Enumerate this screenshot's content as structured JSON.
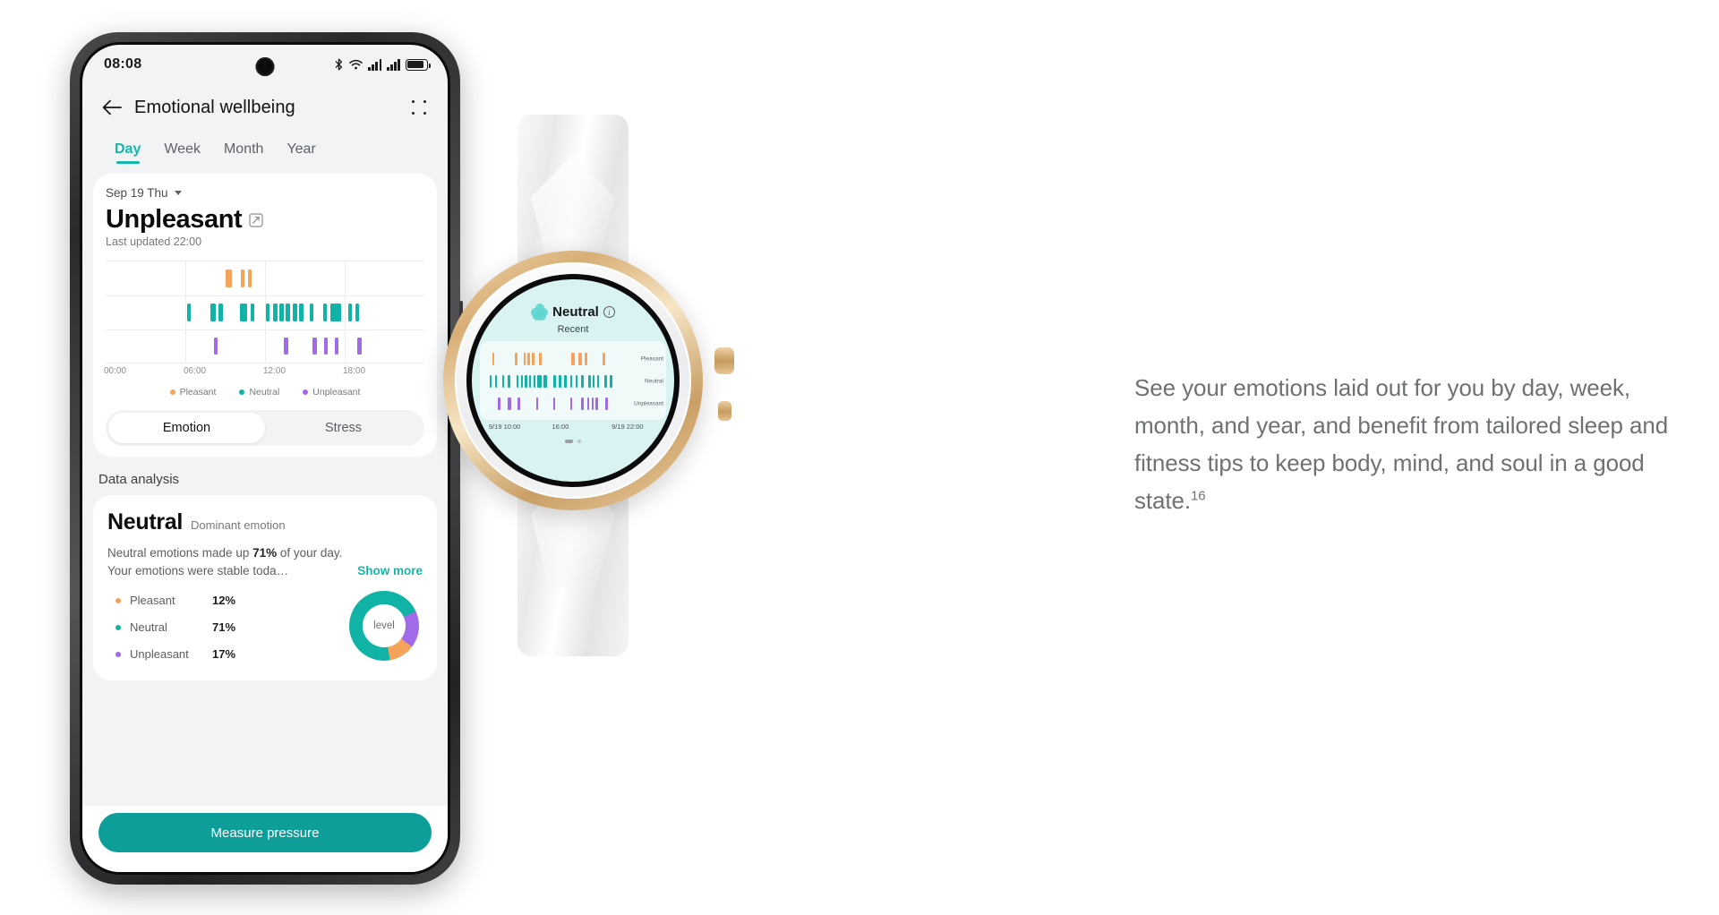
{
  "phone": {
    "status_bar": {
      "time": "08:08",
      "icons": [
        "bluetooth-icon",
        "wifi-icon",
        "signal-icon",
        "signal-icon",
        "battery-icon"
      ]
    },
    "app_bar": {
      "back_icon": "back-arrow-icon",
      "title": "Emotional wellbeing",
      "more_icon": "more-options-icon"
    },
    "tabs": [
      {
        "label": "Day",
        "active": true
      },
      {
        "label": "Week",
        "active": false
      },
      {
        "label": "Month",
        "active": false
      },
      {
        "label": "Year",
        "active": false
      }
    ],
    "summary_card": {
      "date": "Sep 19 Thu",
      "date_caret_icon": "chevron-down-icon",
      "mood": "Unpleasant",
      "edit_icon": "edit-note-icon",
      "last_updated": "Last updated 22:00"
    },
    "segmented": [
      {
        "label": "Emotion",
        "active": true
      },
      {
        "label": "Stress",
        "active": false
      }
    ],
    "data_analysis": {
      "section_title": "Data analysis",
      "dominant_value": "Neutral",
      "dominant_label": "Dominant emotion",
      "summary_line1_pre": "Neutral emotions made up ",
      "summary_line1_bold": "71%",
      "summary_line1_post": " of your day.",
      "summary_line2": "Your emotions were stable toda…",
      "show_more": "Show more",
      "breakdown": [
        {
          "name": "Pleasant",
          "percent": "12%",
          "color": "#f5a35a"
        },
        {
          "name": "Neutral",
          "percent": "71%",
          "color": "#10b3a5"
        },
        {
          "name": "Unpleasant",
          "percent": "17%",
          "color": "#a06ae8"
        }
      ],
      "donut_center_label": "level"
    },
    "measure_button": "Measure pressure"
  },
  "watch": {
    "mood": "Neutral",
    "info_icon": "info-icon",
    "flower_icon": "flower-icon",
    "recent_label": "Recent",
    "lane_labels": [
      "Pleasant",
      "Neutral",
      "Unpleasant"
    ],
    "x_labels": [
      "9/19 10:00",
      "16:00",
      "9/19 22:00"
    ],
    "page_indicator": "page-indicator"
  },
  "copy": {
    "text": "See your emotions laid out for you by day, week, month, and year, and benefit from tailored sleep and fitness tips to keep body, mind, and soul in a good state.",
    "footnote": "16"
  },
  "colors": {
    "accent": "#14b8a8",
    "button": "#0e9e9a",
    "pleasant": "#f5a35a",
    "neutral": "#10b3a5",
    "unpleasant": "#a06ae8"
  },
  "chart_data": {
    "type": "bar",
    "title": "Emotion timeline (Day)",
    "xlabel": "",
    "ylabel": "",
    "x_tick_labels": [
      "00:00",
      "06:00",
      "12:00",
      "18:00"
    ],
    "x_tick_positions_pct": [
      0,
      25,
      50,
      75
    ],
    "xlim_hours": [
      0,
      24
    ],
    "grid": true,
    "legend": [
      "Pleasant",
      "Neutral",
      "Unpleasant"
    ],
    "legend_position": "bottom-center",
    "series": [
      {
        "name": "Pleasant",
        "color": "#f5a35a",
        "lane": 0,
        "events_pct": [
          {
            "x": 37.5,
            "w": 2.2
          },
          {
            "x": 42.5,
            "w": 1.1
          },
          {
            "x": 44.6,
            "w": 1.1
          }
        ]
      },
      {
        "name": "Neutral",
        "color": "#10b3a5",
        "lane": 1,
        "events_pct": [
          {
            "x": 25.5,
            "w": 1.1
          },
          {
            "x": 33.0,
            "w": 1.5
          },
          {
            "x": 35.4,
            "w": 1.5
          },
          {
            "x": 42.0,
            "w": 2.3
          },
          {
            "x": 45.4,
            "w": 1.1
          },
          {
            "x": 50.4,
            "w": 1.1
          },
          {
            "x": 52.6,
            "w": 1.4
          },
          {
            "x": 54.6,
            "w": 1.4
          },
          {
            "x": 56.6,
            "w": 1.4
          },
          {
            "x": 58.6,
            "w": 1.4
          },
          {
            "x": 60.6,
            "w": 1.4
          },
          {
            "x": 64.0,
            "w": 1.1
          },
          {
            "x": 68.2,
            "w": 1.1
          },
          {
            "x": 70.6,
            "w": 3.4
          },
          {
            "x": 76.0,
            "w": 1.2
          },
          {
            "x": 78.4,
            "w": 1.2
          }
        ]
      },
      {
        "name": "Unpleasant",
        "color": "#a06ae8",
        "lane": 2,
        "events_pct": [
          {
            "x": 34.0,
            "w": 1.2
          },
          {
            "x": 56.0,
            "w": 1.2
          },
          {
            "x": 65.0,
            "w": 1.2
          },
          {
            "x": 68.4,
            "w": 1.2
          },
          {
            "x": 71.8,
            "w": 1.2
          },
          {
            "x": 79.0,
            "w": 1.2
          }
        ]
      }
    ]
  },
  "watch_chart_data": {
    "type": "bar",
    "title": "Recent",
    "x_tick_labels": [
      "9/19 10:00",
      "16:00",
      "9/19 22:00"
    ],
    "x_tick_positions_pct": [
      2,
      38,
      72
    ],
    "lanes": [
      "Pleasant",
      "Neutral",
      "Unpleasant"
    ],
    "series": [
      {
        "name": "Pleasant",
        "color": "#f5a35a",
        "lane": 0,
        "events_pct": [
          {
            "x": 5,
            "w": 1.6
          },
          {
            "x": 21,
            "w": 1.6
          },
          {
            "x": 27,
            "w": 1.6
          },
          {
            "x": 30,
            "w": 1.6
          },
          {
            "x": 33,
            "w": 1.6
          },
          {
            "x": 38,
            "w": 1.6
          },
          {
            "x": 61,
            "w": 2.0
          },
          {
            "x": 66,
            "w": 2.6
          },
          {
            "x": 70,
            "w": 2.0
          },
          {
            "x": 83,
            "w": 1.6
          }
        ]
      },
      {
        "name": "Neutral",
        "color": "#10b3a5",
        "lane": 1,
        "events_pct": [
          {
            "x": 3,
            "w": 1.5
          },
          {
            "x": 7,
            "w": 1.5
          },
          {
            "x": 12,
            "w": 1.5
          },
          {
            "x": 16,
            "w": 1.5
          },
          {
            "x": 22,
            "w": 1.5
          },
          {
            "x": 25,
            "w": 1.5
          },
          {
            "x": 28,
            "w": 1.5
          },
          {
            "x": 31,
            "w": 1.5
          },
          {
            "x": 34,
            "w": 1.5
          },
          {
            "x": 37,
            "w": 2.6
          },
          {
            "x": 41,
            "w": 2.6
          },
          {
            "x": 48,
            "w": 2.0
          },
          {
            "x": 52,
            "w": 1.5
          },
          {
            "x": 56,
            "w": 1.5
          },
          {
            "x": 60,
            "w": 1.5
          },
          {
            "x": 64,
            "w": 1.5
          },
          {
            "x": 68,
            "w": 1.5
          },
          {
            "x": 73,
            "w": 1.5
          },
          {
            "x": 76,
            "w": 1.5
          },
          {
            "x": 79,
            "w": 1.5
          },
          {
            "x": 84,
            "w": 1.8
          },
          {
            "x": 88,
            "w": 1.8
          }
        ]
      },
      {
        "name": "Unpleasant",
        "color": "#a06ae8",
        "lane": 2,
        "events_pct": [
          {
            "x": 9,
            "w": 1.6
          },
          {
            "x": 16,
            "w": 2.2
          },
          {
            "x": 23,
            "w": 1.6
          },
          {
            "x": 36,
            "w": 1.6
          },
          {
            "x": 48,
            "w": 1.6
          },
          {
            "x": 60,
            "w": 1.6
          },
          {
            "x": 68,
            "w": 1.6
          },
          {
            "x": 72,
            "w": 1.6
          },
          {
            "x": 75,
            "w": 1.6
          },
          {
            "x": 78,
            "w": 1.6
          },
          {
            "x": 85,
            "w": 1.6
          }
        ]
      }
    ]
  }
}
